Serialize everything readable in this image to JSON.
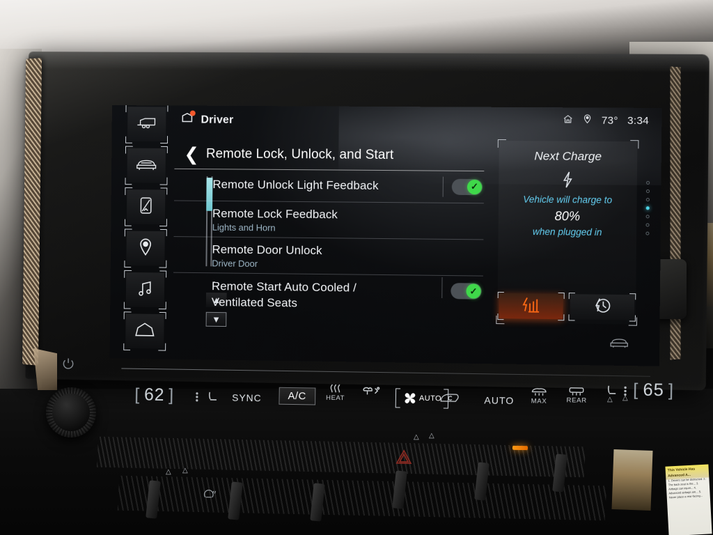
{
  "statusbar": {
    "home_icon": "home-icon",
    "location_icon": "location-pin-icon",
    "temperature": "73°",
    "time": "3:34"
  },
  "profile": {
    "icon": "driver-profile-icon",
    "label": "Driver",
    "badge": "notification-dot"
  },
  "sidebar": {
    "items": [
      {
        "icon": "trailer-icon",
        "name": "sidebar-item-trailer"
      },
      {
        "icon": "vehicle-front-icon",
        "name": "sidebar-item-vehicle"
      },
      {
        "icon": "phone-device-icon",
        "name": "sidebar-item-phone"
      },
      {
        "icon": "location-pin-icon",
        "name": "sidebar-item-navigation"
      },
      {
        "icon": "music-note-icon",
        "name": "sidebar-item-media"
      },
      {
        "icon": "home-icon",
        "name": "sidebar-item-home"
      }
    ]
  },
  "panel": {
    "back_icon": "back-chevron-icon",
    "title": "Remote Lock, Unlock, and Start",
    "rows": [
      {
        "title": "Remote Unlock Light Feedback",
        "subtitle": "",
        "control": "toggle",
        "toggle_on": true
      },
      {
        "title": "Remote Lock Feedback",
        "subtitle": "Lights and Horn",
        "control": "none",
        "toggle_on": false
      },
      {
        "title": "Remote Door Unlock",
        "subtitle": "Driver Door",
        "control": "none",
        "toggle_on": false
      },
      {
        "title": "Remote Start Auto Cooled / Ventilated Seats",
        "subtitle": "",
        "control": "toggle",
        "toggle_on": true
      }
    ],
    "scroll_up_icon": "chevron-up-icon",
    "scroll_down_icon": "chevron-down-icon"
  },
  "charge_widget": {
    "title": "Next Charge",
    "bolt_icon": "lightning-bolt-icon",
    "line1": "Vehicle will charge to",
    "percent": "80%",
    "line2": "when plugged in",
    "buttons": [
      {
        "icon": "charge-rate-icon",
        "name": "charge-now-button",
        "active": true
      },
      {
        "icon": "scheduled-charge-icon",
        "name": "scheduled-charge-button",
        "active": false
      }
    ],
    "page_dots": {
      "total": 7,
      "active_index": 3
    }
  },
  "display_extras": {
    "vehicle_glyph": "vehicle-rear-icon"
  },
  "climate": {
    "driver_temp": "62",
    "passenger_temp": "65",
    "driver_seat_icon": "seat-icon",
    "passenger_seat_icon": "seat-icon",
    "sync_label": "SYNC",
    "ac_label": "A/C",
    "heat_label": "HEAT",
    "heat_icon": "seat-heat-icon",
    "defrost_icon": "windshield-defrost-icon",
    "fan_label": "AUTO",
    "fan_icon": "fan-icon",
    "recirc_icon": "air-recirculation-icon",
    "auto_label": "AUTO",
    "max_label": "MAX",
    "max_icon": "max-defrost-icon",
    "rear_label": "REAR",
    "rear_icon": "rear-defrost-icon"
  },
  "hardware": {
    "power_icon": "power-button-icon",
    "volume_knob": "volume-knob",
    "hazard_icon": "hazard-triangle-icon",
    "steering_heat_icon": "heated-steering-wheel-icon",
    "indicator_led": "amber-indicator-light"
  },
  "sticker": {
    "headline": "This Vehicle Has Advanced A...",
    "body": "1. Drivers can be distracted.  2. The back seat is the... 3. Airbags can injure... 4. Advanced airbags are... 5. Never place a rear-facing..."
  },
  "colors": {
    "accent_cyan": "#63cdf0",
    "toggle_green": "#3fd84a",
    "charge_orange": "#ff6a14",
    "text_primary": "#f3f5f8",
    "text_sub": "#9fb8c8"
  }
}
